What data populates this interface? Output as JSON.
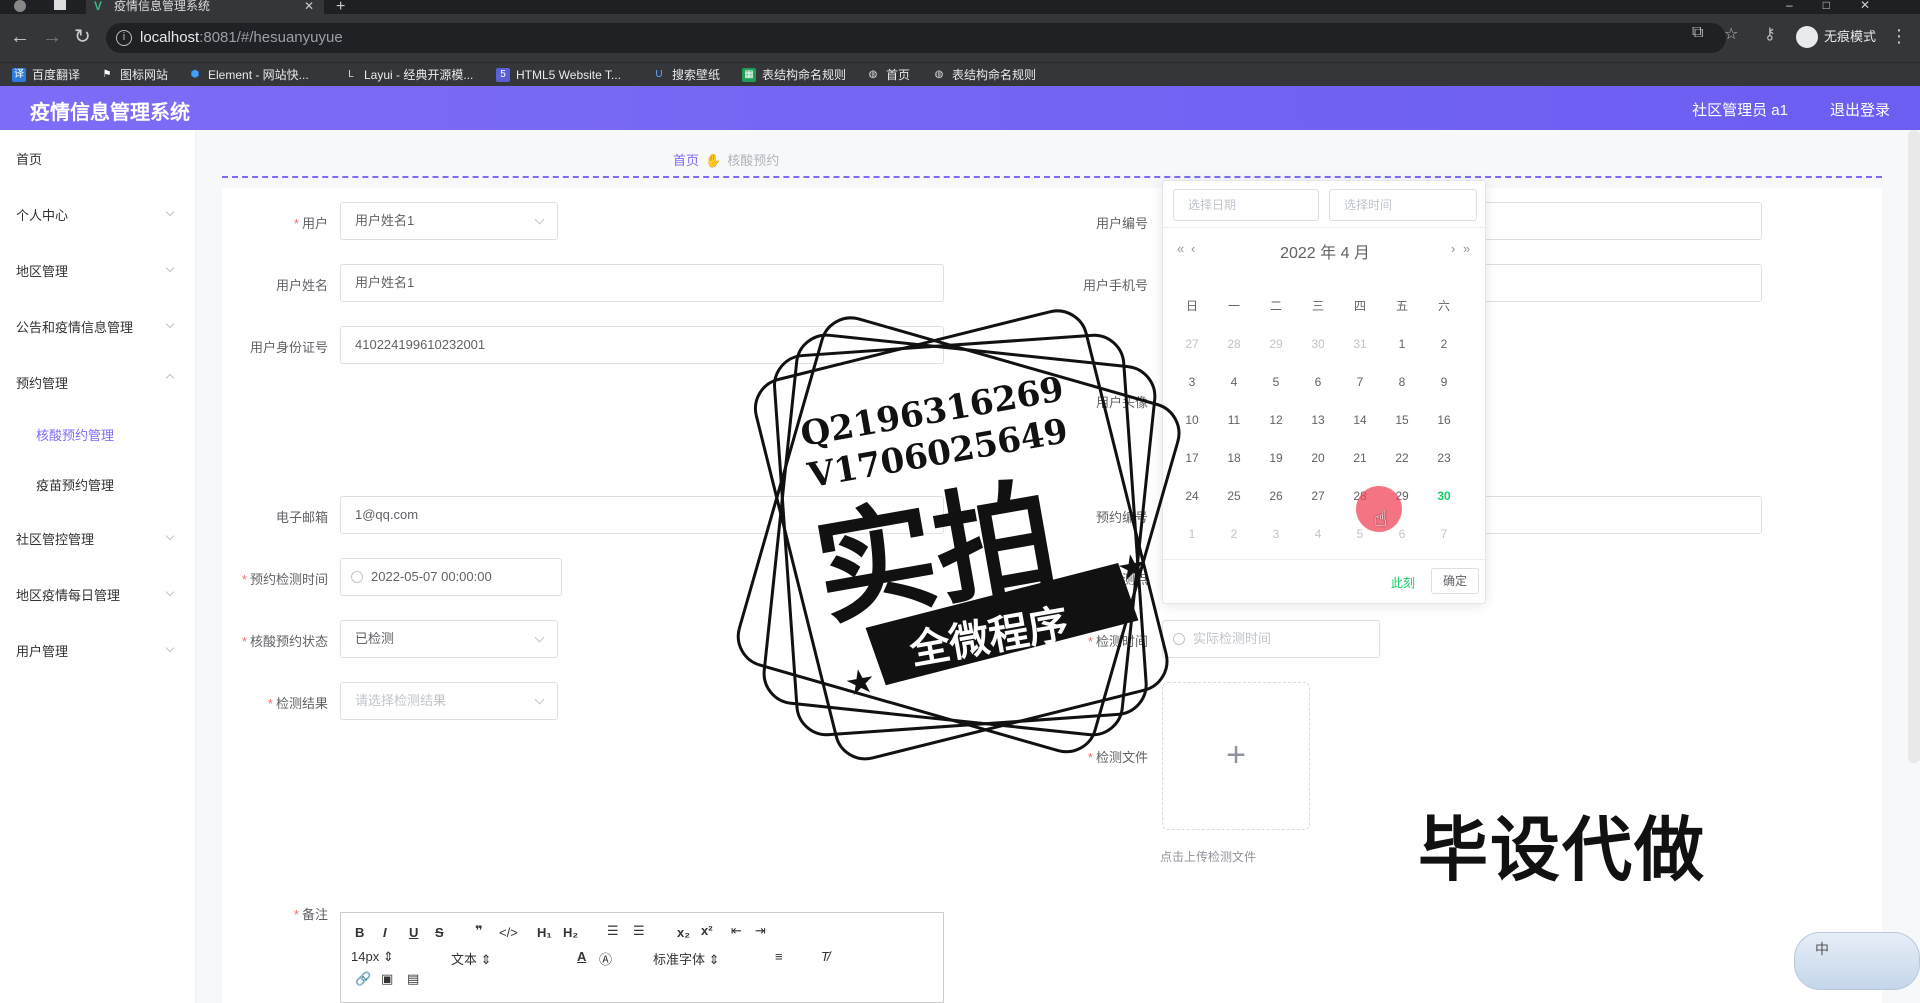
{
  "browser": {
    "tab_title": "疫情信息管理系统",
    "url_host": "localhost",
    "url_path": ":8081/#/hesuanyuyue",
    "incognito_label": "无痕模式",
    "bookmarks": [
      "百度翻译",
      "图标网站",
      "Element - 网站快...",
      "Layui - 经典开源模...",
      "HTML5 Website T...",
      "搜索壁纸",
      "表结构命名规则",
      "首页",
      "表结构命名规则"
    ]
  },
  "header": {
    "title": "疫情信息管理系统",
    "user": "社区管理员 a1",
    "logout": "退出登录"
  },
  "sidebar": {
    "items": [
      "首页",
      "个人中心",
      "地区管理",
      "公告和疫情信息管理",
      "预约管理",
      "社区管控管理",
      "地区疫情每日管理",
      "用户管理"
    ],
    "subitems": [
      "核酸预约管理",
      "疫苗预约管理"
    ]
  },
  "breadcrumb": {
    "home": "首页",
    "current": "核酸预约"
  },
  "form": {
    "user_label": "用户",
    "user_value": "用户姓名1",
    "name_label": "用户姓名",
    "name_value": "用户姓名1",
    "idcard_label": "用户身份证号",
    "idcard_value": "410224199610232001",
    "email_label": "电子邮箱",
    "email_value": "1@qq.com",
    "time_label": "预约检测时间",
    "time_value": "2022-05-07 00:00:00",
    "status_label": "核酸预约状态",
    "status_value": "已检测",
    "result_label": "检测结果",
    "result_placeholder": "请选择检测结果",
    "remark_label": "备注",
    "userno_label": "用户编号",
    "phone_label": "用户手机号",
    "avatar_label": "用户头像",
    "orderno_label": "预约编号",
    "point_label": "检测点",
    "actual_label": "检测时间",
    "actual_placeholder": "实际检测时间",
    "file_label": "检测文件",
    "upload_tip": "点击上传检测文件"
  },
  "editor": {
    "font_size": "14px",
    "block": "文本",
    "font": "标准字体"
  },
  "datepicker": {
    "date_placeholder": "选择日期",
    "time_placeholder": "选择时间",
    "header": "2022 年  4 月",
    "weekdays": [
      "日",
      "一",
      "二",
      "三",
      "四",
      "五",
      "六"
    ],
    "rows": [
      [
        "27",
        "28",
        "29",
        "30",
        "31",
        "1",
        "2"
      ],
      [
        "3",
        "4",
        "5",
        "6",
        "7",
        "8",
        "9"
      ],
      [
        "10",
        "11",
        "12",
        "13",
        "14",
        "15",
        "16"
      ],
      [
        "17",
        "18",
        "19",
        "20",
        "21",
        "22",
        "23"
      ],
      [
        "24",
        "25",
        "26",
        "27",
        "28",
        "29",
        "30"
      ],
      [
        "1",
        "2",
        "3",
        "4",
        "5",
        "6",
        "7"
      ]
    ],
    "now_label": "此刻",
    "confirm_label": "确定"
  },
  "overlay": {
    "line1": "Q2196316269",
    "line2": "V1706025649",
    "big": "实拍",
    "banner": "全微程序",
    "corner": "毕设代做",
    "badge": "中"
  }
}
